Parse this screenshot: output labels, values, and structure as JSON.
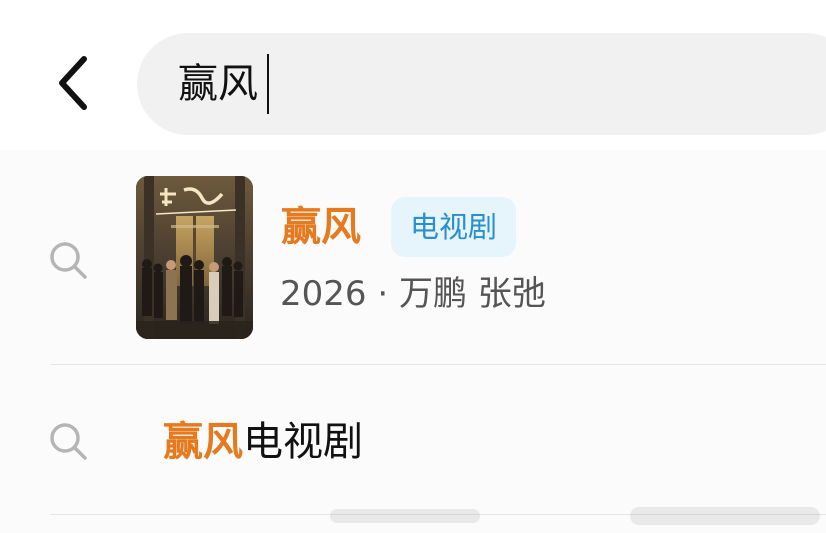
{
  "header": {
    "back_icon": "chevron-left-icon",
    "search": {
      "value": "赢风",
      "placeholder": ""
    }
  },
  "suggestions": [
    {
      "type": "rich",
      "icon": "search-icon",
      "title": "赢风",
      "tag": "电视剧",
      "meta": "2026 · 万鹏 张弛",
      "poster_title": "赢风"
    },
    {
      "type": "simple",
      "icon": "search-icon",
      "highlight": "赢风",
      "rest": "电视剧"
    }
  ],
  "colors": {
    "highlight": "#e57a1f",
    "tag_text": "#2a8fcf",
    "tag_bg": "#e6f4fb",
    "search_bar_bg": "#f1f1f1"
  }
}
